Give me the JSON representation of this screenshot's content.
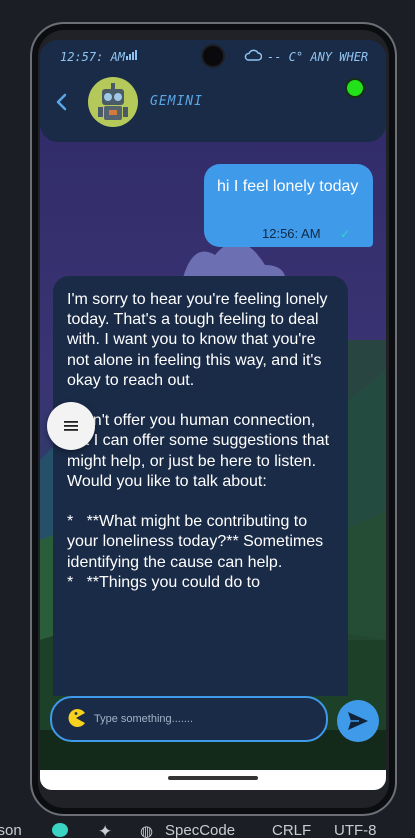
{
  "status_bar": {
    "time": "12:57: AM",
    "weather": "-- C° ANY WHER"
  },
  "header": {
    "contact_name": "GEMINI",
    "status_color": "#22e01a"
  },
  "messages": {
    "outgoing": {
      "text": "hi  I feel lonely today",
      "time": "12:56: AM"
    },
    "incoming": {
      "text": "I'm sorry to hear you're feeling lonely today. That's a tough feeling to deal with. I want you to know that you're not alone in feeling this way, and it's okay to reach out.\n\nI can't offer you human connection, but I can offer some suggestions that might help, or just be here to listen. Would you like to talk about:\n\n*   **What might be contributing to your loneliness today?** Sometimes identifying the cause can help.\n*   **Things you could do to"
    }
  },
  "composer": {
    "placeholder": "Type something......."
  },
  "taskbar": {
    "items": [
      "Json",
      "SpecCode",
      "CRLF",
      "UTF-8"
    ]
  },
  "colors": {
    "accent": "#3f9bea",
    "panel": "#1a2b47",
    "online": "#22e01a"
  }
}
